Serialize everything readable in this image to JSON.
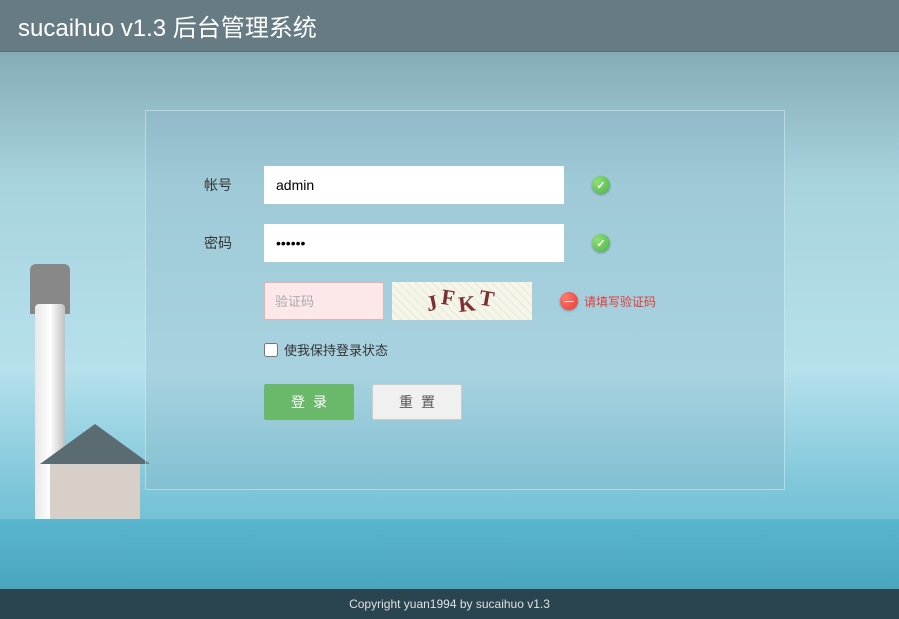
{
  "header": {
    "title": "sucaihuo v1.3 后台管理系统"
  },
  "form": {
    "username": {
      "label": "帐号",
      "value": "admin",
      "valid": true
    },
    "password": {
      "label": "密码",
      "value": "••••••",
      "valid": true
    },
    "captcha": {
      "placeholder": "验证码",
      "image_text": "JFKT",
      "error_message": "请填写验证码"
    },
    "remember": {
      "label": "使我保持登录状态",
      "checked": false
    },
    "buttons": {
      "login": "登录",
      "reset": "重置"
    }
  },
  "footer": {
    "copyright": "Copyright yuan1994 by sucaihuo v1.3"
  }
}
